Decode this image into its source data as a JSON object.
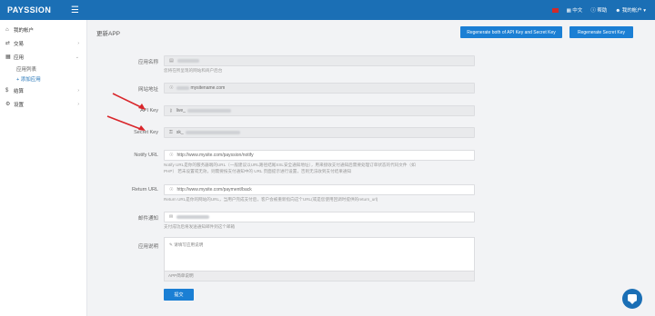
{
  "topbar": {
    "logo": "PAYSSION",
    "menu_icon": "hamburger-icon",
    "lang": "中文",
    "help": "帮助",
    "user": "我的帐户",
    "colors": {
      "bar": "#1b6fb5",
      "flag": "#d02a2a"
    }
  },
  "sidebar": {
    "items": [
      {
        "icon": "home-icon",
        "label": "我的帐户"
      },
      {
        "icon": "transactions-icon",
        "label": "交易"
      },
      {
        "icon": "apps-icon",
        "label": "应用"
      },
      {
        "icon": "dollar-icon",
        "label": "结算"
      },
      {
        "icon": "gear-icon",
        "label": "设置"
      }
    ],
    "sub": [
      {
        "label": "应用列表"
      },
      {
        "label": "+ 添加应用"
      }
    ]
  },
  "main": {
    "title": "更新APP",
    "btn_regen_both": "Regenerate both of API Key and Secret Key",
    "btn_regen_secret": "Regenerate Secret Key",
    "form": {
      "app_name_label": "应用名称",
      "app_name_help": "您将在所呈现的网站和商户后台",
      "site_label": "网站地址",
      "site_value": "mysitename.com",
      "api_label": "API Key",
      "api_value": "live_",
      "secret_label": "Secret Key",
      "secret_value": "sk_",
      "notify_label": "Notify URL",
      "notify_value": "http://www.mysite.com/payssion/notify",
      "notify_help_1": "Notify URL是你的服务器端的URL（一般建议以URL路径结尾SSL安全通知地址），用来接收支付通知后需要处理订单状态的代码文件（如PHP）",
      "notify_help_2": "若未设置或无效，则需要按支付通知中的 URL 页面提示进行设置，否则无法收到支付结果通知",
      "return_label": "Return URL",
      "return_value": "http://www.mysite.com/payment/back",
      "return_help": "Return URL是你的网站的URL，当用户完成支付后，客户会被重新指向这个URL(或是您使用回调时提供的return_url)",
      "email_label": "邮件通知",
      "email_help": "支付成功后将发送通知邮件到这个邮箱",
      "desc_label": "应用说明",
      "desc_value": "请填写应用说明",
      "desc_footer": "APP简单说明",
      "submit": "提交"
    }
  }
}
